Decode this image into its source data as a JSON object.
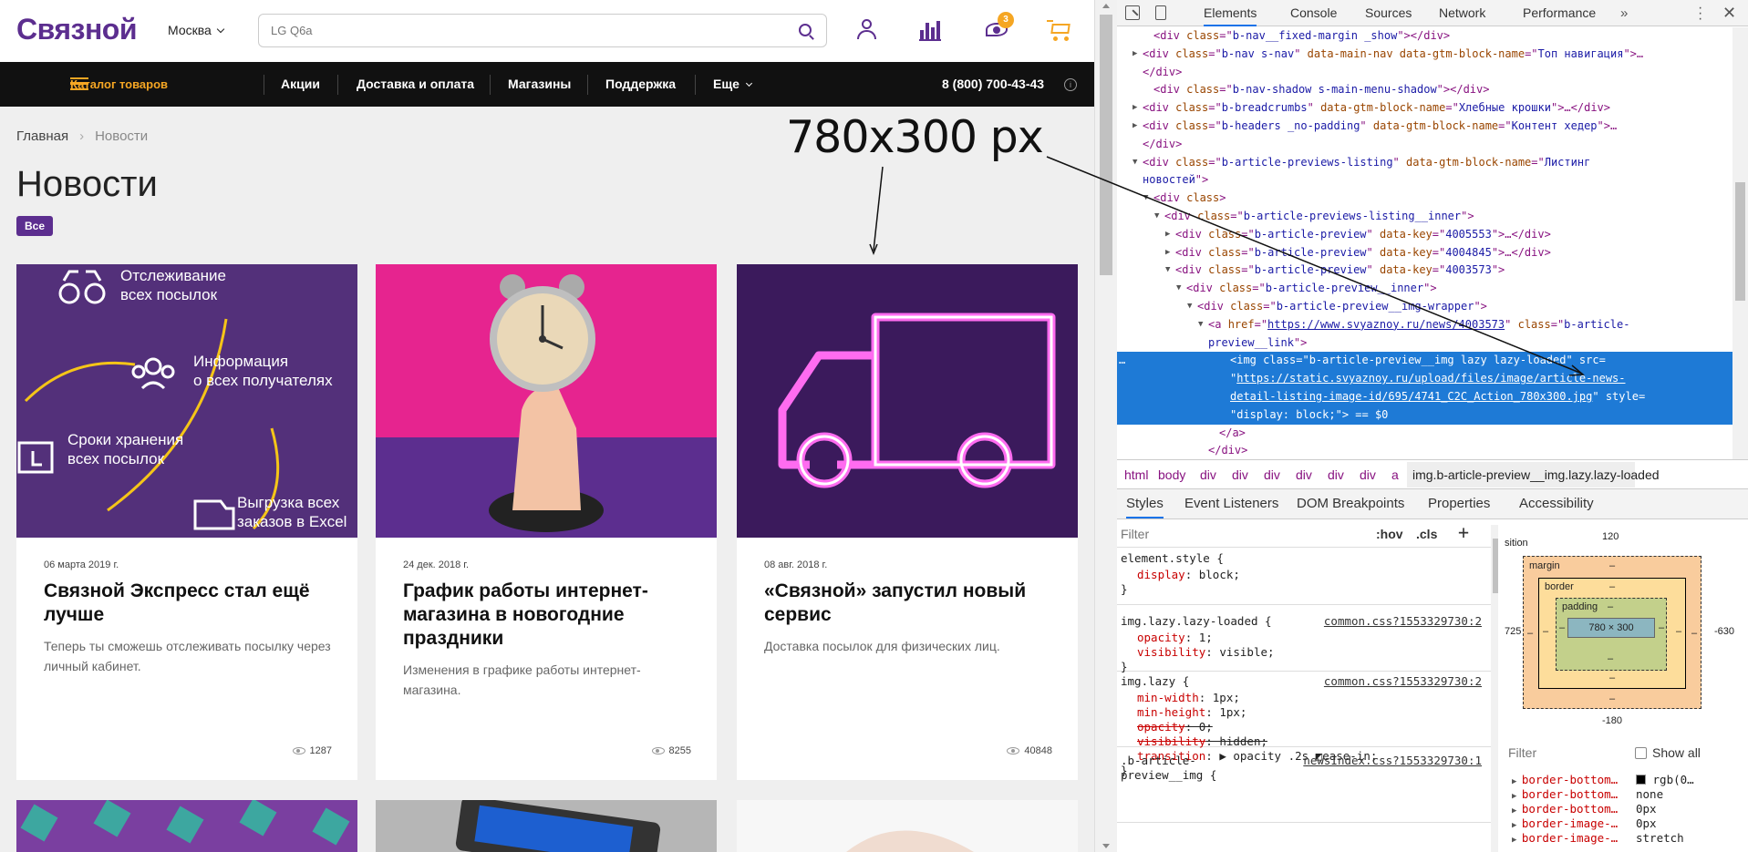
{
  "site": {
    "logo": "Связной",
    "city": "Москва",
    "search_placeholder": "LG Q6a",
    "cart_badge": "3",
    "nav": {
      "catalog": "Каталог товаров",
      "items": [
        "Акции",
        "Доставка и оплата",
        "Магазины",
        "Поддержка",
        "Еще"
      ],
      "phone": "8 (800) 700-43-43"
    },
    "breadcrumbs": {
      "home": "Главная",
      "sep": "›",
      "current": "Новости"
    },
    "title": "Новости",
    "filter_pill": "Все",
    "annotation": "780x300 px",
    "cards": [
      {
        "date": "06 марта 2019 г.",
        "title": "Связной Экспресс стал ещё лучше",
        "desc": "Теперь ты сможешь отслеживать посылку через личный кабинет.",
        "views": "1287",
        "features": [
          "Отслеживание",
          "всех посылок",
          "Информация",
          "о всех получателях",
          "Сроки хранения",
          "всех посылок",
          "Выгрузка всех",
          "заказов в Excel"
        ]
      },
      {
        "date": "24 дек. 2018 г.",
        "title": "График работы интернет-магазина в новогодние праздники",
        "desc": "Изменения в графике работы интернет-магазина.",
        "views": "8255"
      },
      {
        "date": "08 авг. 2018 г.",
        "title": "«Связной» запустил новый сервис",
        "desc": "Доставка посылок для физических лиц.",
        "views": "40848"
      }
    ]
  },
  "devtools": {
    "tabs": [
      "Elements",
      "Console",
      "Sources",
      "Network",
      "Performance"
    ],
    "more_tabs": "»",
    "dom_lines": [
      {
        "indent": 40,
        "arrow": "",
        "parts": [
          [
            "tg",
            "<div "
          ],
          [
            "an",
            "class"
          ],
          [
            "tg",
            "=\""
          ],
          [
            "av",
            "b-nav__fixed-margin _show"
          ],
          [
            "tg",
            "\"></div>"
          ]
        ]
      },
      {
        "indent": 28,
        "arrow": "▶",
        "parts": [
          [
            "tg",
            "<div "
          ],
          [
            "an",
            "class"
          ],
          [
            "tg",
            "=\""
          ],
          [
            "av",
            "b-nav s-nav"
          ],
          [
            "tg",
            "\" "
          ],
          [
            "an",
            "data-main-nav"
          ],
          [
            "tg",
            " "
          ],
          [
            "an",
            "data-gtm-block-name"
          ],
          [
            "tg",
            "=\""
          ],
          [
            "av",
            "Топ навигация"
          ],
          [
            "tg",
            "\">…"
          ]
        ]
      },
      {
        "indent": 28,
        "arrow": "",
        "parts": [
          [
            "tg",
            "</div>"
          ]
        ]
      },
      {
        "indent": 40,
        "arrow": "",
        "parts": [
          [
            "tg",
            "<div "
          ],
          [
            "an",
            "class"
          ],
          [
            "tg",
            "=\""
          ],
          [
            "av",
            "b-nav-shadow s-main-menu-shadow"
          ],
          [
            "tg",
            "\"></div>"
          ]
        ]
      },
      {
        "indent": 28,
        "arrow": "▶",
        "parts": [
          [
            "tg",
            "<div "
          ],
          [
            "an",
            "class"
          ],
          [
            "tg",
            "=\""
          ],
          [
            "av",
            "b-breadcrumbs"
          ],
          [
            "tg",
            "\" "
          ],
          [
            "an",
            "data-gtm-block-name"
          ],
          [
            "tg",
            "=\""
          ],
          [
            "av",
            "Хлебные крошки"
          ],
          [
            "tg",
            "\">…</div>"
          ]
        ]
      },
      {
        "indent": 28,
        "arrow": "▶",
        "parts": [
          [
            "tg",
            "<div "
          ],
          [
            "an",
            "class"
          ],
          [
            "tg",
            "=\""
          ],
          [
            "av",
            "b-headers _no-padding"
          ],
          [
            "tg",
            "\" "
          ],
          [
            "an",
            "data-gtm-block-name"
          ],
          [
            "tg",
            "=\""
          ],
          [
            "av",
            "Контент хедер"
          ],
          [
            "tg",
            "\">…"
          ]
        ]
      },
      {
        "indent": 28,
        "arrow": "",
        "parts": [
          [
            "tg",
            "</div>"
          ]
        ]
      },
      {
        "indent": 28,
        "arrow": "▼",
        "parts": [
          [
            "tg",
            "<div "
          ],
          [
            "an",
            "class"
          ],
          [
            "tg",
            "=\""
          ],
          [
            "av",
            "b-article-previews-listing"
          ],
          [
            "tg",
            "\" "
          ],
          [
            "an",
            "data-gtm-block-name"
          ],
          [
            "tg",
            "=\""
          ],
          [
            "av",
            "Листинг"
          ]
        ]
      },
      {
        "indent": 28,
        "arrow": "",
        "parts": [
          [
            "av",
            "новостей"
          ],
          [
            "tg",
            "\">"
          ]
        ]
      },
      {
        "indent": 40,
        "arrow": "▼",
        "parts": [
          [
            "tg",
            "<div "
          ],
          [
            "an",
            "class"
          ],
          [
            "tg",
            ">"
          ]
        ]
      },
      {
        "indent": 52,
        "arrow": "▼",
        "parts": [
          [
            "tg",
            "<div "
          ],
          [
            "an",
            "class"
          ],
          [
            "tg",
            "=\""
          ],
          [
            "av",
            "b-article-previews-listing__inner"
          ],
          [
            "tg",
            "\">"
          ]
        ]
      },
      {
        "indent": 64,
        "arrow": "▶",
        "parts": [
          [
            "tg",
            "<div "
          ],
          [
            "an",
            "class"
          ],
          [
            "tg",
            "=\""
          ],
          [
            "av",
            "b-article-preview"
          ],
          [
            "tg",
            "\" "
          ],
          [
            "an",
            "data-key"
          ],
          [
            "tg",
            "=\""
          ],
          [
            "av",
            "4005553"
          ],
          [
            "tg",
            "\">…</div>"
          ]
        ]
      },
      {
        "indent": 64,
        "arrow": "▶",
        "parts": [
          [
            "tg",
            "<div "
          ],
          [
            "an",
            "class"
          ],
          [
            "tg",
            "=\""
          ],
          [
            "av",
            "b-article-preview"
          ],
          [
            "tg",
            "\" "
          ],
          [
            "an",
            "data-key"
          ],
          [
            "tg",
            "=\""
          ],
          [
            "av",
            "4004845"
          ],
          [
            "tg",
            "\">…</div>"
          ]
        ]
      },
      {
        "indent": 64,
        "arrow": "▼",
        "parts": [
          [
            "tg",
            "<div "
          ],
          [
            "an",
            "class"
          ],
          [
            "tg",
            "=\""
          ],
          [
            "av",
            "b-article-preview"
          ],
          [
            "tg",
            "\" "
          ],
          [
            "an",
            "data-key"
          ],
          [
            "tg",
            "=\""
          ],
          [
            "av",
            "4003573"
          ],
          [
            "tg",
            "\">"
          ]
        ]
      },
      {
        "indent": 76,
        "arrow": "▼",
        "parts": [
          [
            "tg",
            "<div "
          ],
          [
            "an",
            "class"
          ],
          [
            "tg",
            "=\""
          ],
          [
            "av",
            "b-article-preview__inner"
          ],
          [
            "tg",
            "\">"
          ]
        ]
      },
      {
        "indent": 88,
        "arrow": "▼",
        "parts": [
          [
            "tg",
            "<div "
          ],
          [
            "an",
            "class"
          ],
          [
            "tg",
            "=\""
          ],
          [
            "av",
            "b-article-preview__img-wrapper"
          ],
          [
            "tg",
            "\">"
          ]
        ]
      },
      {
        "indent": 100,
        "arrow": "▼",
        "parts": [
          [
            "tg",
            "<a "
          ],
          [
            "an",
            "href"
          ],
          [
            "tg",
            "=\""
          ],
          [
            "lk",
            "https://www.svyaznoy.ru/news/4003573"
          ],
          [
            "tg",
            "\" "
          ],
          [
            "an",
            "class"
          ],
          [
            "tg",
            "=\""
          ],
          [
            "av",
            "b-article-"
          ]
        ]
      },
      {
        "indent": 100,
        "arrow": "",
        "parts": [
          [
            "av",
            "preview__link"
          ],
          [
            "tg",
            "\">"
          ]
        ]
      },
      {
        "indent": 124,
        "arrow": "",
        "sel": true,
        "parts": [
          [
            "tg",
            "<img "
          ],
          [
            "an",
            "class"
          ],
          [
            "tg",
            "=\""
          ],
          [
            "av",
            "b-article-preview__img lazy lazy-loaded"
          ],
          [
            "tg",
            "\" "
          ],
          [
            "an",
            "src"
          ],
          [
            "tg",
            "="
          ]
        ]
      },
      {
        "indent": 124,
        "arrow": "",
        "sel": true,
        "parts": [
          [
            "tg",
            "\""
          ],
          [
            "lk",
            "https://static.svyaznoy.ru/upload/files/image/article-news-"
          ]
        ]
      },
      {
        "indent": 124,
        "arrow": "",
        "sel": true,
        "parts": [
          [
            "lk",
            "detail-listing-image-id/695/4741_C2C_Action_780x300.jpg"
          ],
          [
            "tg",
            "\" "
          ],
          [
            "an",
            "style"
          ],
          [
            "tg",
            "="
          ]
        ]
      },
      {
        "indent": 124,
        "arrow": "",
        "sel": true,
        "parts": [
          [
            "tg",
            "\""
          ],
          [
            "av",
            "display: block;"
          ],
          [
            "tg",
            "\"> == $0"
          ]
        ]
      },
      {
        "indent": 112,
        "arrow": "",
        "parts": [
          [
            "tg",
            "</a>"
          ]
        ]
      },
      {
        "indent": 100,
        "arrow": "",
        "parts": [
          [
            "tg",
            "</div>"
          ]
        ]
      },
      {
        "indent": 88,
        "arrow": "▶",
        "parts": [
          [
            "tg",
            "<div "
          ],
          [
            "an",
            "class"
          ],
          [
            "tg",
            "=\""
          ],
          [
            "av",
            "b-article-preview__content"
          ],
          [
            "tg",
            "\">…</div>"
          ]
        ]
      }
    ],
    "ellipsis": "…",
    "breadcrumb_path": [
      "html",
      "body",
      "div",
      "div",
      "div",
      "div",
      "div",
      "div",
      "a",
      "img.b-article-preview__img.lazy.lazy-loaded"
    ],
    "subtabs": [
      "Styles",
      "Event Listeners",
      "DOM Breakpoints",
      "Properties",
      "Accessibility"
    ],
    "filter_placeholder": "Filter",
    "hov": ":hov",
    "cls": ".cls",
    "plus": "+",
    "rules": [
      {
        "selector": "element.style {",
        "source": "",
        "props": [
          [
            "display",
            "block",
            false
          ]
        ]
      },
      {
        "selector": "img.lazy.lazy-loaded {",
        "source": "common.css?1553329730:2",
        "props": [
          [
            "opacity",
            "1",
            false
          ],
          [
            "visibility",
            "visible",
            false
          ]
        ]
      },
      {
        "selector": "img.lazy {",
        "source": "common.css?1553329730:2",
        "props": [
          [
            "min-width",
            "1px",
            false
          ],
          [
            "min-height",
            "1px",
            false
          ],
          [
            "opacity",
            "0",
            true
          ],
          [
            "visibility",
            "hidden",
            true
          ],
          [
            "transition",
            "▶ opacity .2s ◩ease-in",
            false
          ]
        ]
      },
      {
        "selector": ".b-article-",
        "source": "newsIndex.css?1553329730:1",
        "props": []
      }
    ],
    "rule4_line2": "preview__img {",
    "boxmodel": {
      "position_label": "sition",
      "pos_top": "120",
      "pos_left": "725",
      "pos_right": "-630",
      "pos_bottom": "-180",
      "margin": "margin",
      "border": "border",
      "padding": "padding",
      "content": "780 × 300",
      "dash": "–"
    },
    "filter2_placeholder": "Filter",
    "show_all": "Show all",
    "computed": [
      {
        "name": "border-bottom…",
        "value": "rgb(0…",
        "swatch": "#000000"
      },
      {
        "name": "border-bottom…",
        "value": "none"
      },
      {
        "name": "border-bottom…",
        "value": "0px"
      },
      {
        "name": "border-image-…",
        "value": "0px"
      },
      {
        "name": "border-image-…",
        "value": "stretch"
      }
    ]
  }
}
